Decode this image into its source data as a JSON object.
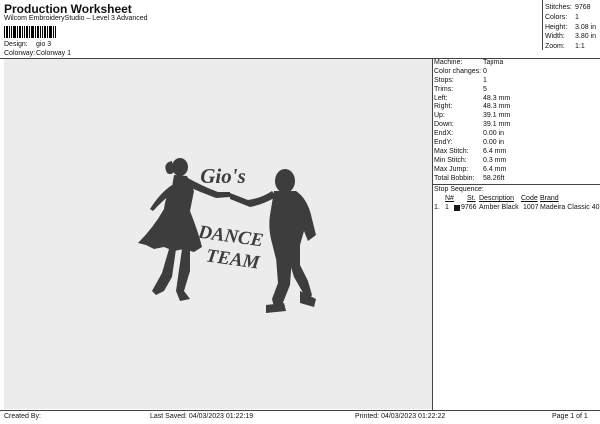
{
  "header": {
    "title": "Production Worksheet",
    "subtitle": "Wilcom EmbroideryStudio – Level 3 Advanced"
  },
  "meta": {
    "design_label": "Design:",
    "design_value": "gio 3",
    "colorway_label": "Colorway:",
    "colorway_value": "Colorway 1"
  },
  "summary": [
    {
      "label": "Stitches:",
      "value": "9768"
    },
    {
      "label": "Colors:",
      "value": "1"
    },
    {
      "label": "Height:",
      "value": "3.08 in"
    },
    {
      "label": "Width:",
      "value": "3.80 in"
    },
    {
      "label": "Zoom:",
      "value": "1:1"
    }
  ],
  "design": {
    "text_line1": "Gio's",
    "text_line2": "DANCE",
    "text_line3": "TEAM",
    "thread_color": "#3d3d3d"
  },
  "properties": [
    {
      "label": "Machine:",
      "value": "Tajima"
    },
    {
      "label": "Color changes:",
      "value": "0"
    },
    {
      "label": "Stops:",
      "value": "1"
    },
    {
      "label": "Trims:",
      "value": "5"
    },
    {
      "label": "Left:",
      "value": "48.3 mm"
    },
    {
      "label": "Right:",
      "value": "48.3 mm"
    },
    {
      "label": "Up:",
      "value": "39.1 mm"
    },
    {
      "label": "Down:",
      "value": "39.1 mm"
    },
    {
      "label": "EndX:",
      "value": "0.00 in"
    },
    {
      "label": "EndY:",
      "value": "0.00 in"
    },
    {
      "label": "Max Stitch:",
      "value": "6.4 mm"
    },
    {
      "label": "Min Stitch:",
      "value": "0.3 mm"
    },
    {
      "label": "Max Jump:",
      "value": "6.4 mm"
    },
    {
      "label": "Total Bobbin:",
      "value": "58.26ft"
    }
  ],
  "stop_sequence": {
    "title": "Stop Sequence:",
    "headers": {
      "n": "N#",
      "st": "St.",
      "description": "Description",
      "code": "Code",
      "brand": "Brand"
    },
    "rows": [
      {
        "index": "1.",
        "n": "1",
        "swatch": "#1a1a1a",
        "st": "9766",
        "description": "Amber Black",
        "code": "1007",
        "brand": "Madeira Classic 40"
      }
    ]
  },
  "footer": {
    "created_by": "Created By:",
    "last_saved": "Last Saved: 04/03/2023 01:22:19",
    "printed": "Printed: 04/03/2023 01:22:22",
    "page": "Page 1 of 1"
  }
}
